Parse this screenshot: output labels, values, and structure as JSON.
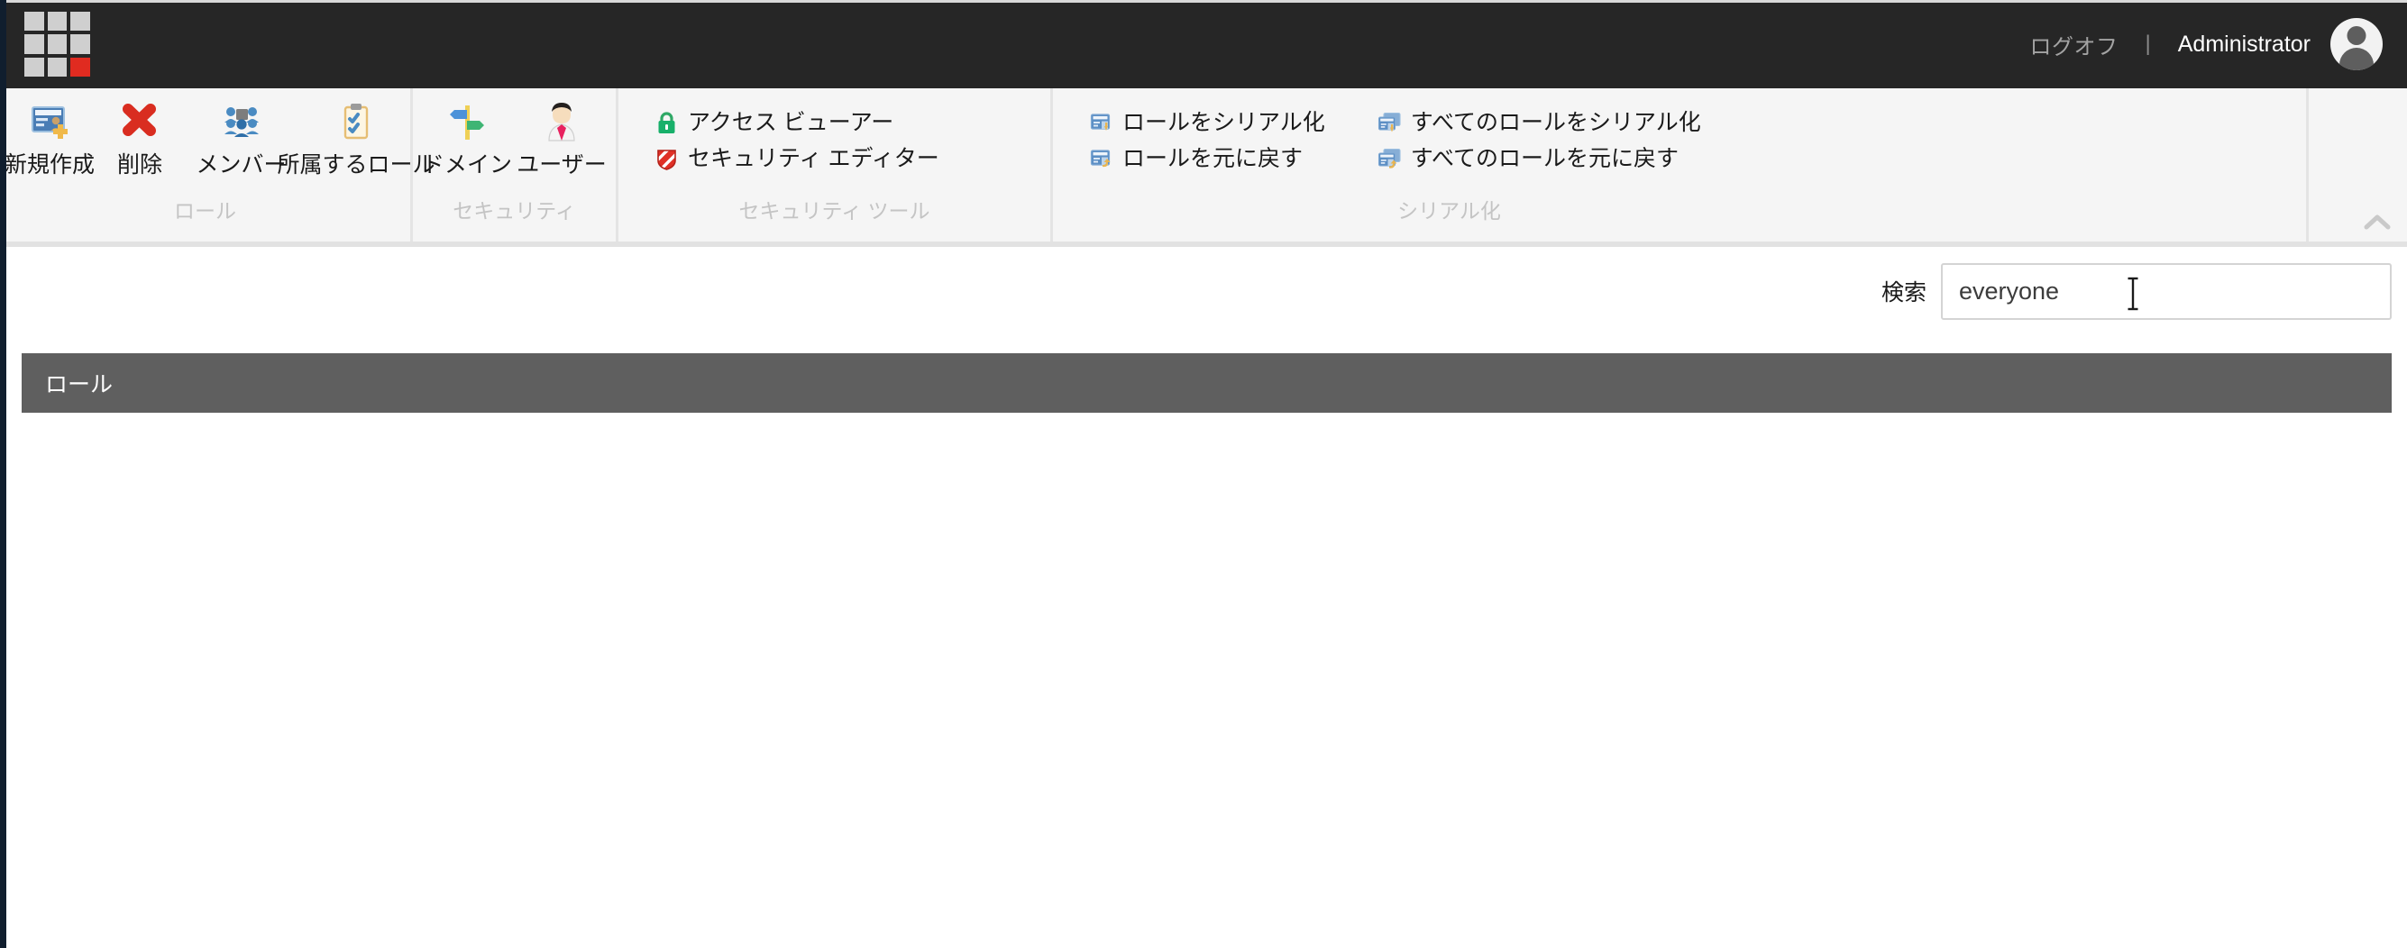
{
  "header": {
    "logo_name": "app-launcher-logo",
    "logoff_label": "ログオフ",
    "separator": "|",
    "user_name": "Administrator",
    "accent_color": "#e02b20",
    "background_color": "#262626"
  },
  "ribbon": {
    "groups": [
      {
        "label": "ロール",
        "layout": "big",
        "buttons": [
          {
            "label": "新規作成",
            "icon": "new-role-card-icon"
          },
          {
            "label": "削除",
            "icon": "delete-cross-icon"
          },
          {
            "label": "メンバー",
            "icon": "members-group-icon"
          },
          {
            "label": "所属するロール",
            "icon": "clipboard-checklist-icon"
          }
        ]
      },
      {
        "label": "セキュリティ",
        "layout": "big",
        "buttons": [
          {
            "label": "ドメイン",
            "icon": "signpost-icon"
          },
          {
            "label": "ユーザー",
            "icon": "user-person-icon"
          }
        ]
      },
      {
        "label": "セキュリティ ツール",
        "layout": "small",
        "buttons": [
          {
            "label": "アクセス ビューアー",
            "icon": "green-lock-icon"
          },
          {
            "label": "セキュリティ エディター",
            "icon": "red-shield-icon"
          }
        ]
      },
      {
        "label": "シリアル化",
        "layout": "small-two-column",
        "columns": [
          [
            {
              "label": "ロールをシリアル化",
              "icon": "serialize-role-icon"
            },
            {
              "label": "ロールを元に戻す",
              "icon": "restore-role-icon"
            }
          ],
          [
            {
              "label": "すべてのロールをシリアル化",
              "icon": "serialize-all-roles-icon"
            },
            {
              "label": "すべてのロールを元に戻す",
              "icon": "restore-all-roles-icon"
            }
          ]
        ]
      }
    ],
    "collapse_icon": "chevron-up-icon"
  },
  "search": {
    "label": "検索",
    "value": "everyone",
    "placeholder": ""
  },
  "table": {
    "columns": [
      "ロール"
    ],
    "header_background": "#5f5f5f",
    "rows": []
  }
}
